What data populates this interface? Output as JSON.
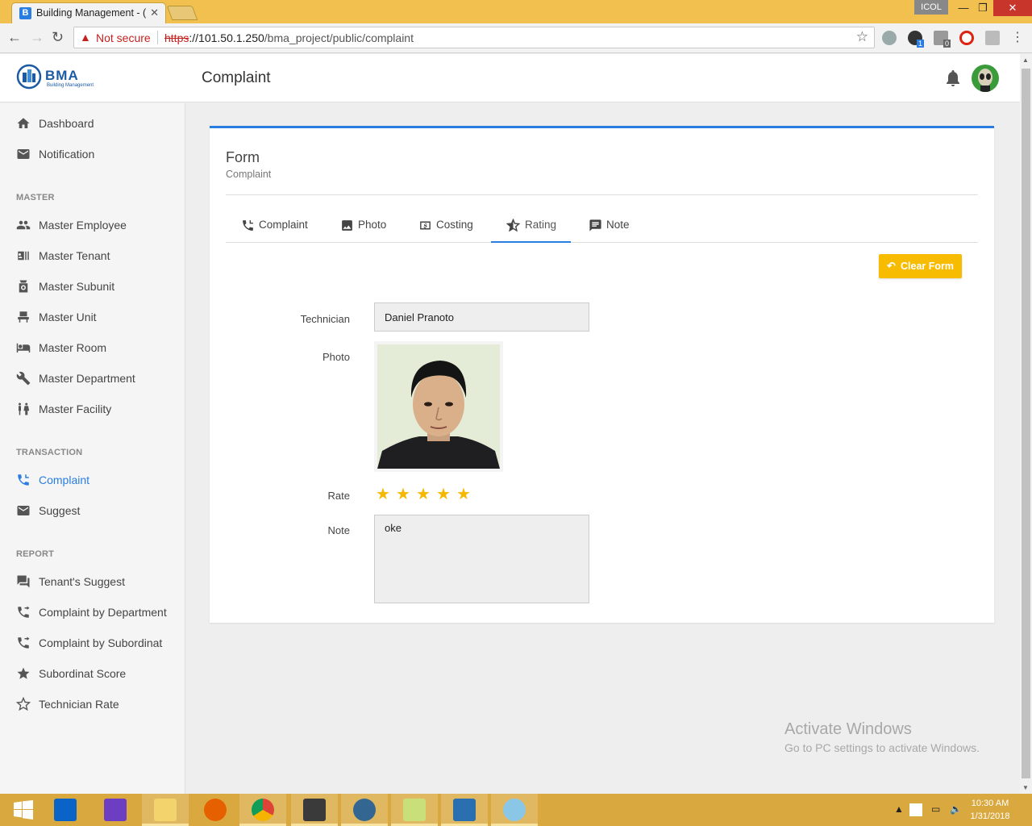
{
  "browser": {
    "tab_title": "Building Management - (",
    "tab_favicon": "B",
    "profile": "ICOL",
    "security_label": "Not secure",
    "url_scheme": "https",
    "url_host": "://101.50.1.250",
    "url_path": "/bma_project/public/complaint",
    "ext_badge_1": "1",
    "ext_badge_2": "0"
  },
  "app": {
    "logo_text": "BMA",
    "logo_sub": "Building Management",
    "page_title": "Complaint"
  },
  "sidebar": {
    "items_top": [
      {
        "label": "Dashboard",
        "icon": "home-icon"
      },
      {
        "label": "Notification",
        "icon": "mail-icon"
      }
    ],
    "section_master": "MASTER",
    "items_master": [
      {
        "label": "Master Employee",
        "icon": "people-icon"
      },
      {
        "label": "Master Tenant",
        "icon": "tenant-icon"
      },
      {
        "label": "Master Subunit",
        "icon": "subunit-icon"
      },
      {
        "label": "Master Unit",
        "icon": "chair-icon"
      },
      {
        "label": "Master Room",
        "icon": "bed-icon"
      },
      {
        "label": "Master Department",
        "icon": "wrench-icon"
      },
      {
        "label": "Master Facility",
        "icon": "restroom-icon"
      }
    ],
    "section_transaction": "TRANSACTION",
    "items_transaction": [
      {
        "label": "Complaint",
        "icon": "phone-icon",
        "active": true
      },
      {
        "label": "Suggest",
        "icon": "mail-icon"
      }
    ],
    "section_report": "REPORT",
    "items_report": [
      {
        "label": "Tenant's Suggest",
        "icon": "chat-icon"
      },
      {
        "label": "Complaint by Department",
        "icon": "phone-forward-icon"
      },
      {
        "label": "Complaint by Subordinat",
        "icon": "phone-forward-icon"
      },
      {
        "label": "Subordinat Score",
        "icon": "star-filled-icon"
      },
      {
        "label": "Technician Rate",
        "icon": "star-outline-icon"
      }
    ]
  },
  "form": {
    "title": "Form",
    "subtitle": "Complaint",
    "tabs": [
      {
        "label": "Complaint",
        "icon": "phone-icon"
      },
      {
        "label": "Photo",
        "icon": "image-icon"
      },
      {
        "label": "Costing",
        "icon": "money-icon"
      },
      {
        "label": "Rating",
        "icon": "star-half-icon",
        "active": true
      },
      {
        "label": "Note",
        "icon": "note-icon"
      }
    ],
    "clear_button": "Clear Form",
    "technician_label": "Technician",
    "technician_value": "Daniel Pranoto",
    "photo_label": "Photo",
    "rate_label": "Rate",
    "rate_value": 5,
    "rate_max": 5,
    "note_label": "Note",
    "note_value": "oke"
  },
  "watermark": {
    "line1": "Activate Windows",
    "line2": "Go to PC settings to activate Windows."
  },
  "taskbar": {
    "time": "10:30 AM",
    "date": "1/31/2018"
  },
  "colors": {
    "accent": "#2a7de1",
    "warning_button": "#f7bb00",
    "star": "#f5b800",
    "taskbar": "#d9a93f",
    "tabbar": "#f2c04f"
  }
}
